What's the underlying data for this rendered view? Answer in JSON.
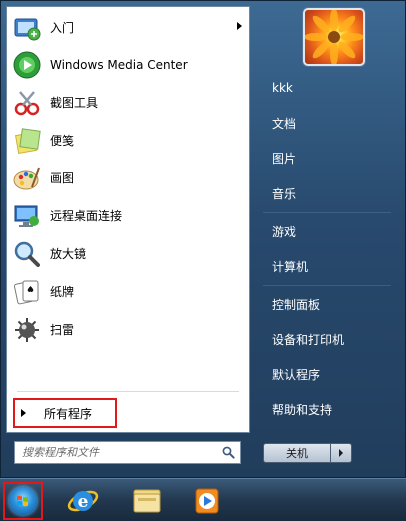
{
  "programs": [
    {
      "label": "入门",
      "icon": "getting-started-icon",
      "has_submenu": true
    },
    {
      "label": "Windows Media Center",
      "icon": "media-center-icon",
      "has_submenu": false
    },
    {
      "label": "截图工具",
      "icon": "snipping-tool-icon",
      "has_submenu": false
    },
    {
      "label": "便笺",
      "icon": "sticky-notes-icon",
      "has_submenu": false
    },
    {
      "label": "画图",
      "icon": "paint-icon",
      "has_submenu": false
    },
    {
      "label": "远程桌面连接",
      "icon": "remote-desktop-icon",
      "has_submenu": false
    },
    {
      "label": "放大镜",
      "icon": "magnifier-icon",
      "has_submenu": false
    },
    {
      "label": "纸牌",
      "icon": "solitaire-icon",
      "has_submenu": false
    },
    {
      "label": "扫雷",
      "icon": "minesweeper-icon",
      "has_submenu": false
    }
  ],
  "all_programs": {
    "label": "所有程序"
  },
  "search": {
    "placeholder": "搜索程序和文件"
  },
  "right_items": [
    "kkk",
    "文档",
    "图片",
    "音乐",
    "游戏",
    "计算机",
    "控制面板",
    "设备和打印机",
    "默认程序",
    "帮助和支持"
  ],
  "shutdown": {
    "label": "关机"
  },
  "taskbar": {
    "icons": [
      "internet-explorer-icon",
      "windows-explorer-icon",
      "media-player-icon"
    ]
  },
  "colors": {
    "highlight_border": "#e31919",
    "menu_glass": "#284a6e"
  }
}
